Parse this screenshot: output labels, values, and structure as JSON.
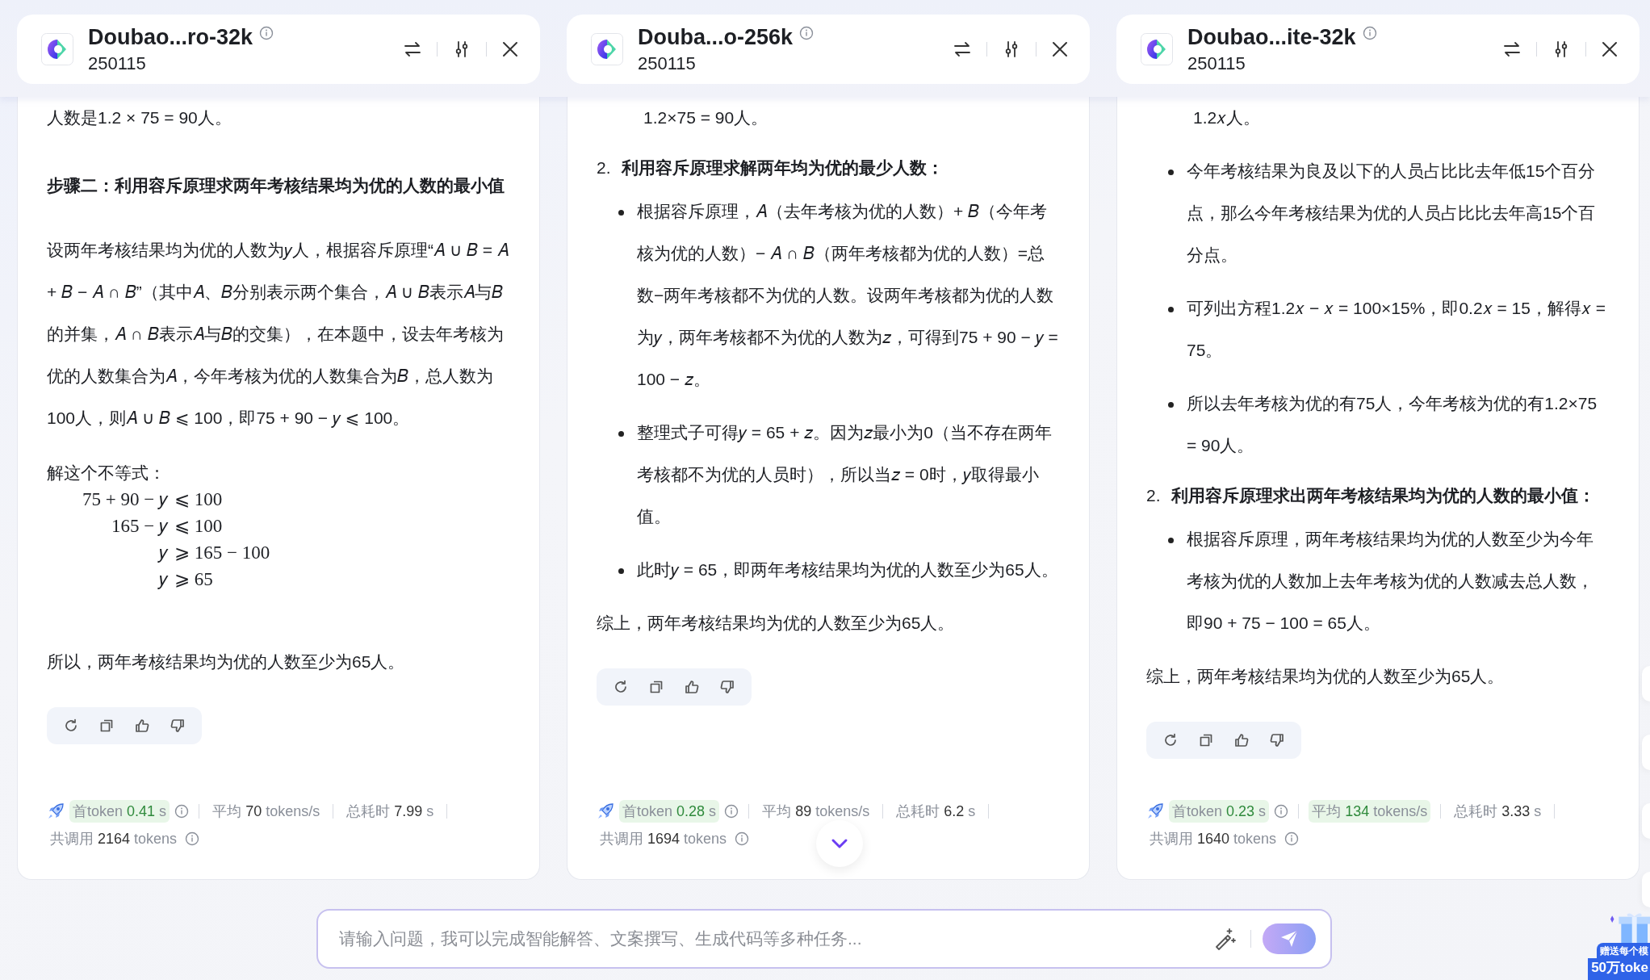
{
  "panels": [
    {
      "header": {
        "model": "Doubao...ro-32k",
        "version": "250115"
      },
      "blocks": [
        {
          "kind": "para",
          "text": "人数是1.2 × 75 = 90人。"
        },
        {
          "kind": "bold",
          "text": "步骤二：利用容斥原理求两年考核结果均为优的人数的最小值"
        },
        {
          "kind": "para",
          "text": "设两年考核结果均为优的人数为𝑦人，根据容斥原理“𝐴 ∪ 𝐵 = 𝐴 + 𝐵 − 𝐴 ∩ 𝐵”（其中𝐴、𝐵分别表示两个集合，𝐴 ∪ 𝐵表示𝐴与𝐵的并集，𝐴 ∩ 𝐵表示𝐴与𝐵的交集），在本题中，设去年考核为优的人数集合为𝐴，今年考核为优的人数集合为𝐵，总人数为100人，则𝐴 ∪ 𝐵 ⩽ 100，即75 + 90 − 𝑦 ⩽ 100。"
        },
        {
          "kind": "plain",
          "text": "解这个不等式："
        },
        {
          "kind": "math",
          "rows": [
            {
              "lhs": "75 + 90 − 𝑦",
              "rhs": "⩽ 100"
            },
            {
              "lhs": "165 − 𝑦",
              "rhs": "⩽ 100"
            },
            {
              "lhs": "𝑦",
              "rhs": "⩾ 165 − 100"
            },
            {
              "lhs": "𝑦",
              "rhs": "⩾ 65"
            }
          ]
        },
        {
          "kind": "para",
          "text": "所以，两年考核结果均为优的人数至少为65人。"
        }
      ],
      "stats": [
        {
          "kind": "first_token",
          "label": "首token",
          "value": "0.41",
          "unit": "s",
          "highlight": true,
          "info": true
        },
        {
          "kind": "speed",
          "label": "平均",
          "value": "70",
          "unit": "tokens/s",
          "highlight": false,
          "info": false
        },
        {
          "kind": "duration",
          "label": "总耗时",
          "value": "7.99",
          "unit": "s",
          "highlight": false,
          "info": false
        },
        {
          "kind": "total",
          "label": "共调用",
          "value": "2164",
          "unit": "tokens",
          "highlight": false,
          "info": true
        }
      ]
    },
    {
      "header": {
        "model": "Douba...o-256k",
        "version": "250115"
      },
      "blocks": [
        {
          "kind": "cont",
          "text": "1.2×75 = 90人。"
        },
        {
          "kind": "numbered",
          "number": "2.",
          "text": "利用容斥原理求解两年均为优的最少人数：",
          "children": [
            {
              "kind": "bullet",
              "text": "根据容斥原理，𝐴（去年考核为优的人数）+ 𝐵（今年考核为优的人数）− 𝐴 ∩ 𝐵（两年考核都为优的人数）=总数−两年考核都不为优的人数。设两年考核都为优的人数为𝑦，两年考核都不为优的人数为𝑧，可得到75 + 90 − 𝑦 = 100 − 𝑧。"
            },
            {
              "kind": "bullet",
              "text": "整理式子可得𝑦 = 65 + 𝑧。因为𝑧最小为0（当不存在两年考核都不为优的人员时），所以当𝑧 = 0时，𝑦取得最小值。"
            },
            {
              "kind": "bullet",
              "text": "此时𝑦 = 65，即两年考核结果均为优的人数至少为65人。"
            }
          ]
        },
        {
          "kind": "para",
          "text": "综上，两年考核结果均为优的人数至少为65人。"
        }
      ],
      "stats": [
        {
          "kind": "first_token",
          "label": "首token",
          "value": "0.28",
          "unit": "s",
          "highlight": true,
          "info": true
        },
        {
          "kind": "speed",
          "label": "平均",
          "value": "89",
          "unit": "tokens/s",
          "highlight": false,
          "info": false
        },
        {
          "kind": "duration",
          "label": "总耗时",
          "value": "6.2",
          "unit": "s",
          "highlight": false,
          "info": false
        },
        {
          "kind": "total",
          "label": "共调用",
          "value": "1694",
          "unit": "tokens",
          "highlight": false,
          "info": true
        }
      ]
    },
    {
      "header": {
        "model": "Doubao...ite-32k",
        "version": "250115"
      },
      "blocks": [
        {
          "kind": "cont",
          "text": "1.2𝑥人。"
        },
        {
          "kind": "bullet",
          "text": "今年考核结果为良及以下的人员占比比去年低15个百分点，那么今年考核结果为优的人员占比比去年高15个百分点。"
        },
        {
          "kind": "bullet",
          "text": "可列出方程1.2𝑥 − 𝑥 = 100×15%，即0.2𝑥 = 15，解得𝑥 = 75。"
        },
        {
          "kind": "bullet",
          "text": "所以去年考核为优的有75人，今年考核为优的有1.2×75 = 90人。"
        },
        {
          "kind": "numbered",
          "number": "2.",
          "text": "利用容斥原理求出两年考核结果均为优的人数的最小值：",
          "children": [
            {
              "kind": "bullet",
              "text": "根据容斥原理，两年考核结果均为优的人数至少为今年考核为优的人数加上去年考核为优的人数减去总人数，即90 + 75 − 100 = 65人。"
            }
          ]
        },
        {
          "kind": "para",
          "text": "综上，两年考核结果均为优的人数至少为65人。"
        }
      ],
      "stats": [
        {
          "kind": "first_token",
          "label": "首token",
          "value": "0.23",
          "unit": "s",
          "highlight": true,
          "info": true
        },
        {
          "kind": "speed",
          "label": "平均",
          "value": "134",
          "unit": "tokens/s",
          "highlight": true,
          "info": false
        },
        {
          "kind": "duration",
          "label": "总耗时",
          "value": "3.33",
          "unit": "s",
          "highlight": false,
          "info": false
        },
        {
          "kind": "total",
          "label": "共调用",
          "value": "1640",
          "unit": "tokens",
          "highlight": false,
          "info": true
        }
      ]
    }
  ],
  "input": {
    "placeholder": "请输入问题，我可以完成智能解答、文案撰写、生成代码等多种任务..."
  },
  "promo": {
    "line1": "赠送每个模",
    "line2": "50万toke"
  }
}
